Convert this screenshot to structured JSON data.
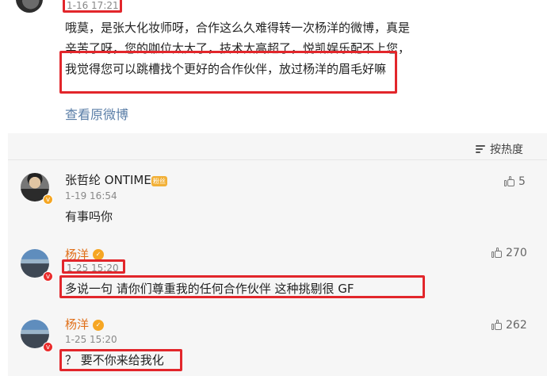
{
  "post": {
    "time": "1-16 17:21",
    "text": "哦莫，是张大化妆师呀，合作这么久难得转一次杨洋的微博，真是辛苦了呀，您的咖位太大了，技术太高超了，悦凯娱乐配不上您，我觉得您可以跳槽找个更好的合作伙伴，放过杨洋的眉毛好嘛",
    "view_original": "查看原微博"
  },
  "comments_header": {
    "sort_label": "按热度"
  },
  "comments": [
    {
      "username": "张哲纶 ONTIME",
      "badge": "粉丝",
      "time": "1-19 16:54",
      "text": "有事吗你",
      "likes": "5"
    },
    {
      "username": "杨洋",
      "badge": "✓",
      "time": "1-25 15:20",
      "text": "多说一句 请你们尊重我的任何合作伙伴 这种挑剔很 GF",
      "likes": "270"
    },
    {
      "username": "杨洋",
      "badge": "✓",
      "time": "1-25 15:20",
      "text": "？ 要不你来给我化",
      "likes": "262"
    }
  ],
  "icons": {
    "sort": "sort-icon",
    "like": "thumbs-up-icon",
    "vip": "v-badge-icon"
  },
  "colors": {
    "highlight": "#e2262b",
    "link": "#5a7ea7",
    "orange_name": "#e06f19",
    "panel_bg": "#f6f6f6"
  }
}
